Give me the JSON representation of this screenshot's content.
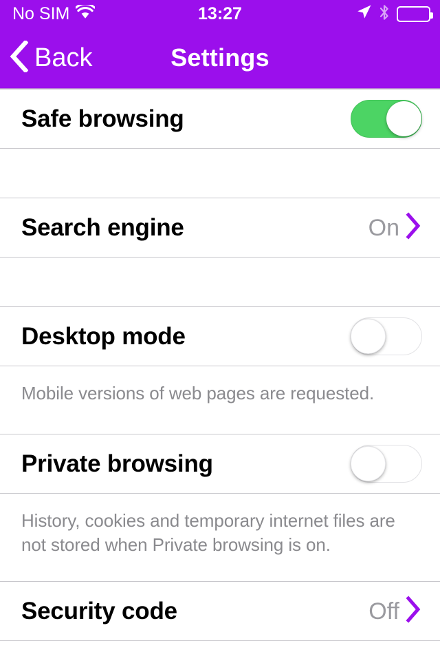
{
  "status_bar": {
    "carrier": "No SIM",
    "wifi_icon": "wifi-icon",
    "time": "13:27",
    "location_icon": "location-arrow-icon",
    "bluetooth_icon": "bluetooth-icon",
    "battery_icon": "battery-icon"
  },
  "nav_bar": {
    "back_label": "Back",
    "back_icon": "chevron-left-icon",
    "title": "Settings",
    "background_color": "#9B0FEC",
    "text_color": "#ffffff"
  },
  "colors": {
    "accent_purple": "#9B0FEC",
    "toggle_on_green": "#4CD464",
    "separator_gray": "#c8c7cc",
    "value_gray": "#9a9a9f",
    "footer_gray": "#8a8a8e"
  },
  "sections": [
    {
      "rows": [
        {
          "label": "Safe browsing",
          "control": "toggle",
          "toggle_state": "on"
        }
      ],
      "footer": ""
    },
    {
      "rows": [
        {
          "label": "Search engine",
          "control": "disclosure",
          "value": "On",
          "chevron_icon": "chevron-right-icon"
        }
      ],
      "footer": ""
    },
    {
      "rows": [
        {
          "label": "Desktop mode",
          "control": "toggle",
          "toggle_state": "off"
        }
      ],
      "footer": "Mobile versions of web pages are requested."
    },
    {
      "rows": [
        {
          "label": "Private browsing",
          "control": "toggle",
          "toggle_state": "off"
        }
      ],
      "footer": "History, cookies and temporary internet files are not stored when Private browsing is on."
    },
    {
      "rows": [
        {
          "label": "Security code",
          "control": "disclosure",
          "value": "Off",
          "chevron_icon": "chevron-right-icon"
        }
      ],
      "footer": ""
    }
  ]
}
